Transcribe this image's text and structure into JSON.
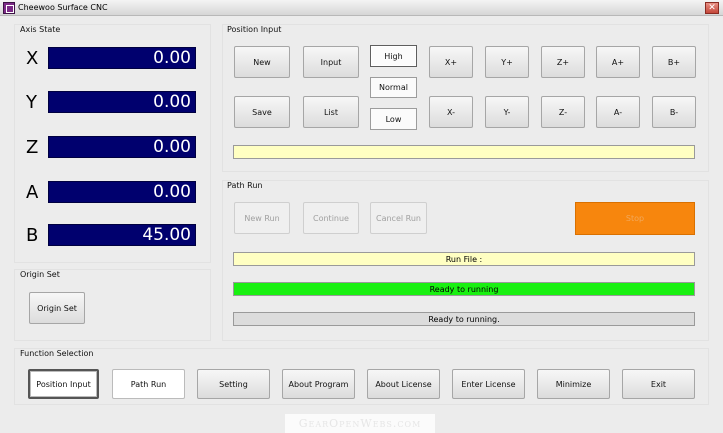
{
  "window": {
    "title": "Cheewoo Surface CNC",
    "close_label": "✕"
  },
  "axis_state": {
    "title": "Axis State",
    "axes": [
      {
        "letter": "X",
        "value": "0.00"
      },
      {
        "letter": "Y",
        "value": "0.00"
      },
      {
        "letter": "Z",
        "value": "0.00"
      },
      {
        "letter": "A",
        "value": "0.00"
      },
      {
        "letter": "B",
        "value": "45.00"
      }
    ]
  },
  "position_input": {
    "title": "Position Input",
    "new_label": "New",
    "input_label": "Input",
    "save_label": "Save",
    "list_label": "List",
    "speed": {
      "high": "High",
      "normal": "Normal",
      "low": "Low",
      "selected": "High"
    },
    "jog_plus": [
      "X+",
      "Y+",
      "Z+",
      "A+",
      "B+"
    ],
    "jog_minus": [
      "X-",
      "Y-",
      "Z-",
      "A-",
      "B-"
    ],
    "position_field": ""
  },
  "path_run": {
    "title": "Path Run",
    "new_run_label": "New Run",
    "continue_label": "Continue",
    "cancel_run_label": "Cancel Run",
    "stop_label": "Stop",
    "run_file": "Run File :",
    "status_green": "Ready to running",
    "status_gray": "Ready to running."
  },
  "origin_set": {
    "title": "Origin Set",
    "button_label": "Origin Set"
  },
  "function_selection": {
    "title": "Function Selection",
    "buttons": [
      "Position Input",
      "Path Run",
      "Setting",
      "About Program",
      "About License",
      "Enter License",
      "Minimize",
      "Exit"
    ]
  },
  "watermark": {
    "text": "GearOpenWebs.com"
  },
  "colors": {
    "axis_display": "#00006e",
    "stop": "#f7860d",
    "ready_green": "#19f011",
    "field_yellow": "#ffffc2"
  }
}
